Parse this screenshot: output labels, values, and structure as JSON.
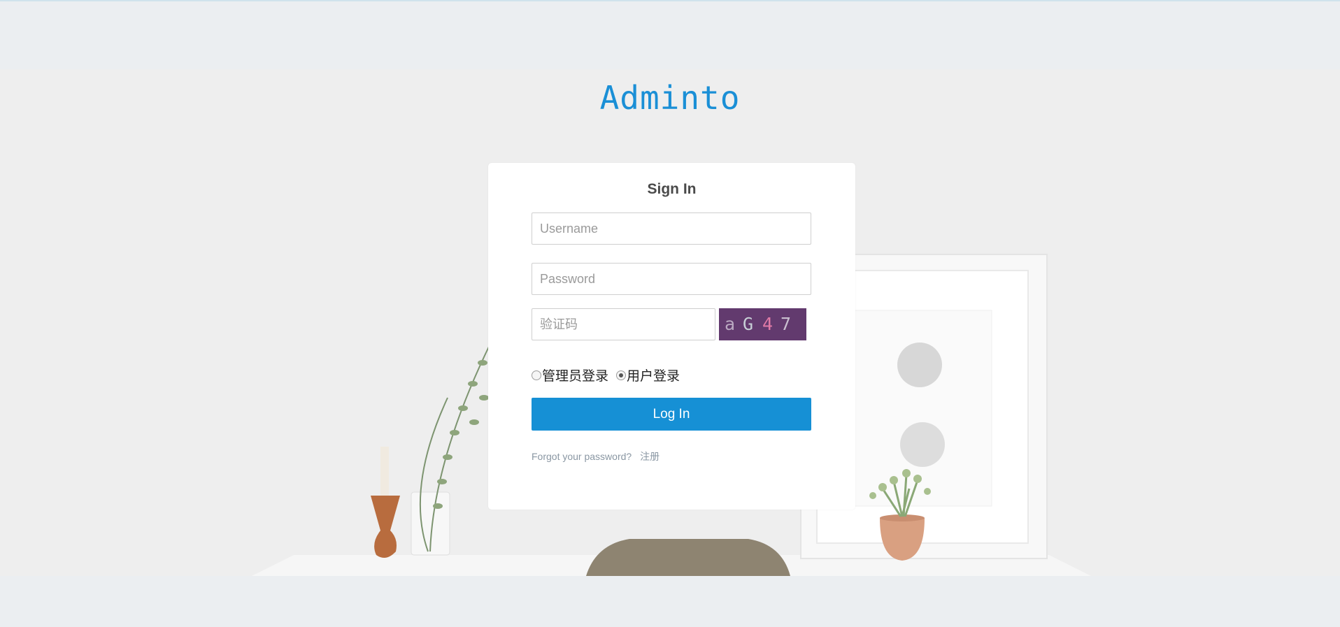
{
  "brand": {
    "name": "Adminto"
  },
  "signin": {
    "title": "Sign In",
    "username_placeholder": "Username",
    "username_value": "",
    "password_placeholder": "Password",
    "password_value": "",
    "captcha_placeholder": "验证码",
    "captcha_value": "",
    "captcha_chars": [
      "a",
      "G",
      "4",
      "7"
    ],
    "roles": [
      {
        "label": "管理员登录",
        "checked": false
      },
      {
        "label": "用户登录",
        "checked": true
      }
    ],
    "login_label": "Log In",
    "forgot_label": "Forgot your password?",
    "register_label": "注册"
  },
  "colors": {
    "accent": "#1690d5",
    "brand": "#1a8fd6",
    "captcha_bg": "#623a6e",
    "page_bg": "#ebeef1"
  }
}
